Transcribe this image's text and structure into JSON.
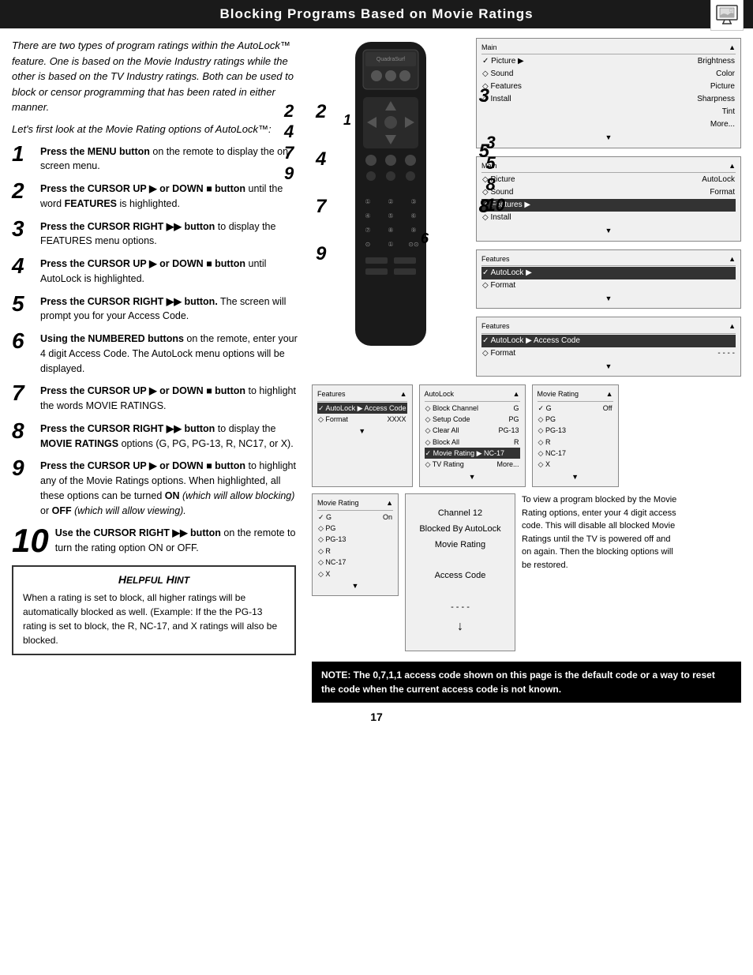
{
  "header": {
    "title": "Blocking Programs Based on Movie Ratings",
    "icon_alt": "TV icon"
  },
  "intro": {
    "paragraph": "There are two types of program ratings within the AutoLock™ feature. One is based on the Movie Industry ratings while the other is based on the TV Industry ratings. Both can be used to block or censor programming that has been rated in either manner.",
    "subtitle": "Let's first look at the Movie Rating options of AutoLock™:"
  },
  "steps": [
    {
      "num": "1",
      "large": false,
      "text": "Press the MENU button on the remote to display the on-screen menu."
    },
    {
      "num": "2",
      "large": false,
      "text": "Press the CURSOR UP ▶ or DOWN ■ button until the word FEATURES is highlighted."
    },
    {
      "num": "3",
      "large": false,
      "text": "Press the CURSOR RIGHT ▶▶ button to display the FEATURES menu options."
    },
    {
      "num": "4",
      "large": false,
      "text": "Press the CURSOR UP ▶ or DOWN ■ button until AutoLock is highlighted."
    },
    {
      "num": "5",
      "large": false,
      "text": "Press the CURSOR RIGHT ▶▶ button. The screen will prompt you for your Access Code."
    },
    {
      "num": "6",
      "large": false,
      "text": "Using the NUMBERED buttons on the remote, enter your 4 digit Access Code. The AutoLock menu options will be displayed."
    },
    {
      "num": "7",
      "large": false,
      "text": "Press the CURSOR UP ▶ or DOWN ■ button to highlight the words MOVIE RATINGS."
    },
    {
      "num": "8",
      "large": false,
      "text": "Press the CURSOR RIGHT ▶▶ button to display the MOVIE RATINGS options (G, PG, PG-13, R, NC17, or X)."
    },
    {
      "num": "9",
      "large": false,
      "text": "Press the CURSOR UP ▶ or DOWN ■ button to highlight any of the Movie Ratings options. When highlighted, all these options can be turned ON (which will allow blocking) or OFF (which will allow viewing)."
    },
    {
      "num": "10",
      "large": true,
      "text": "Use the CURSOR RIGHT ▶▶ button on the remote to turn the rating option ON or OFF."
    }
  ],
  "helpful_hint": {
    "title": "Helpful Hint",
    "text": "When a rating is set to block, all higher ratings will be automatically blocked as well. (Example: If the the PG-13 rating is set to block, the R, NC-17, and X ratings will also be blocked."
  },
  "menu_screen_1": {
    "header": [
      "Main",
      "▲"
    ],
    "rows": [
      {
        "label": "✓ Picture",
        "value": "▶ Brightness",
        "highlight": false
      },
      {
        "label": "◇ Sound",
        "value": "Color",
        "highlight": false
      },
      {
        "label": "◇ Features",
        "value": "Picture",
        "highlight": false
      },
      {
        "label": "◇ Install",
        "value": "Sharpness",
        "highlight": false
      },
      {
        "label": "",
        "value": "Tint",
        "highlight": false
      },
      {
        "label": "",
        "value": "More...",
        "highlight": false
      }
    ],
    "step_label": "2"
  },
  "menu_screen_2": {
    "header": [
      "Main",
      "▲"
    ],
    "rows": [
      {
        "label": "◇ Picture",
        "value": "AutoLock",
        "highlight": false
      },
      {
        "label": "◇ Sound",
        "value": "Format",
        "highlight": false
      },
      {
        "label": "✓ Features",
        "value": "▶",
        "highlight": true
      },
      {
        "label": "◇ Install",
        "value": "",
        "highlight": false
      }
    ],
    "step_label": "3"
  },
  "menu_screen_3": {
    "header": [
      "Features",
      "▲"
    ],
    "rows": [
      {
        "label": "✓ AutoLock",
        "value": "▶",
        "highlight": true
      },
      {
        "label": "◇ Format",
        "value": "",
        "highlight": false
      }
    ],
    "step_label": "5"
  },
  "menu_screen_4": {
    "header": [
      "Features",
      "▲"
    ],
    "rows": [
      {
        "label": "✓ AutoLock",
        "value": "▶ Access Code",
        "highlight": true
      },
      {
        "label": "◇ Format",
        "value": "- - - -",
        "highlight": false
      }
    ],
    "step_label": "6"
  },
  "autolock_screen": {
    "header": [
      "AutoLock",
      "▲"
    ],
    "rows": [
      {
        "label": "◇ Block Channel",
        "value": "G"
      },
      {
        "label": "◇ Setup Code",
        "value": "PG"
      },
      {
        "label": "◇ Clear All",
        "value": "PG-13"
      },
      {
        "label": "◇ Block All",
        "value": "R"
      },
      {
        "label": "✓ Movie Rating",
        "value": "▶ NC-17"
      },
      {
        "label": "◇ TV Rating",
        "value": "More..."
      }
    ],
    "step_label": "8"
  },
  "movie_rating_screen": {
    "header": [
      "Movie Rating",
      "▲"
    ],
    "rows": [
      {
        "label": "✓ G",
        "value": "Off"
      },
      {
        "label": "◇ PG",
        "value": ""
      },
      {
        "label": "◇ PG-13",
        "value": ""
      },
      {
        "label": "◇ R",
        "value": ""
      },
      {
        "label": "◇ NC-17",
        "value": ""
      },
      {
        "label": "◇ X",
        "value": ""
      }
    ],
    "step_label": "9"
  },
  "access_code_screen": {
    "header": [
      "Features",
      "▲"
    ],
    "rows": [
      {
        "label": "✓ AutoLock",
        "value": "▶ Access Code"
      },
      {
        "label": "◇ Format",
        "value": "XXXX"
      }
    ]
  },
  "movie_rating_on_screen": {
    "header": [
      "Movie Rating",
      "▲"
    ],
    "rows": [
      {
        "label": "✓ G",
        "value": "On"
      },
      {
        "label": "◇ PG",
        "value": ""
      },
      {
        "label": "◇ PG-13",
        "value": ""
      },
      {
        "label": "◇ R",
        "value": ""
      },
      {
        "label": "◇ NC-17",
        "value": ""
      },
      {
        "label": "◇ X",
        "value": ""
      }
    ],
    "step_label": "10"
  },
  "channel_blocked": {
    "line1": "Channel 12",
    "line2": "Blocked By AutoLock",
    "line3": "Movie Rating",
    "line4": "Access Code",
    "line5": "- - - -"
  },
  "note": {
    "text": "NOTE: The 0,7,1,1 access code shown on this page is the default code or a way to reset the code when the current access code is not known."
  },
  "side_note": {
    "text": "To view a program blocked by the Movie Rating options, enter your 4 digit access code. This will disable all blocked Movie Ratings until the TV is powered off and on again. Then the blocking options will be restored."
  },
  "page_number": "17"
}
